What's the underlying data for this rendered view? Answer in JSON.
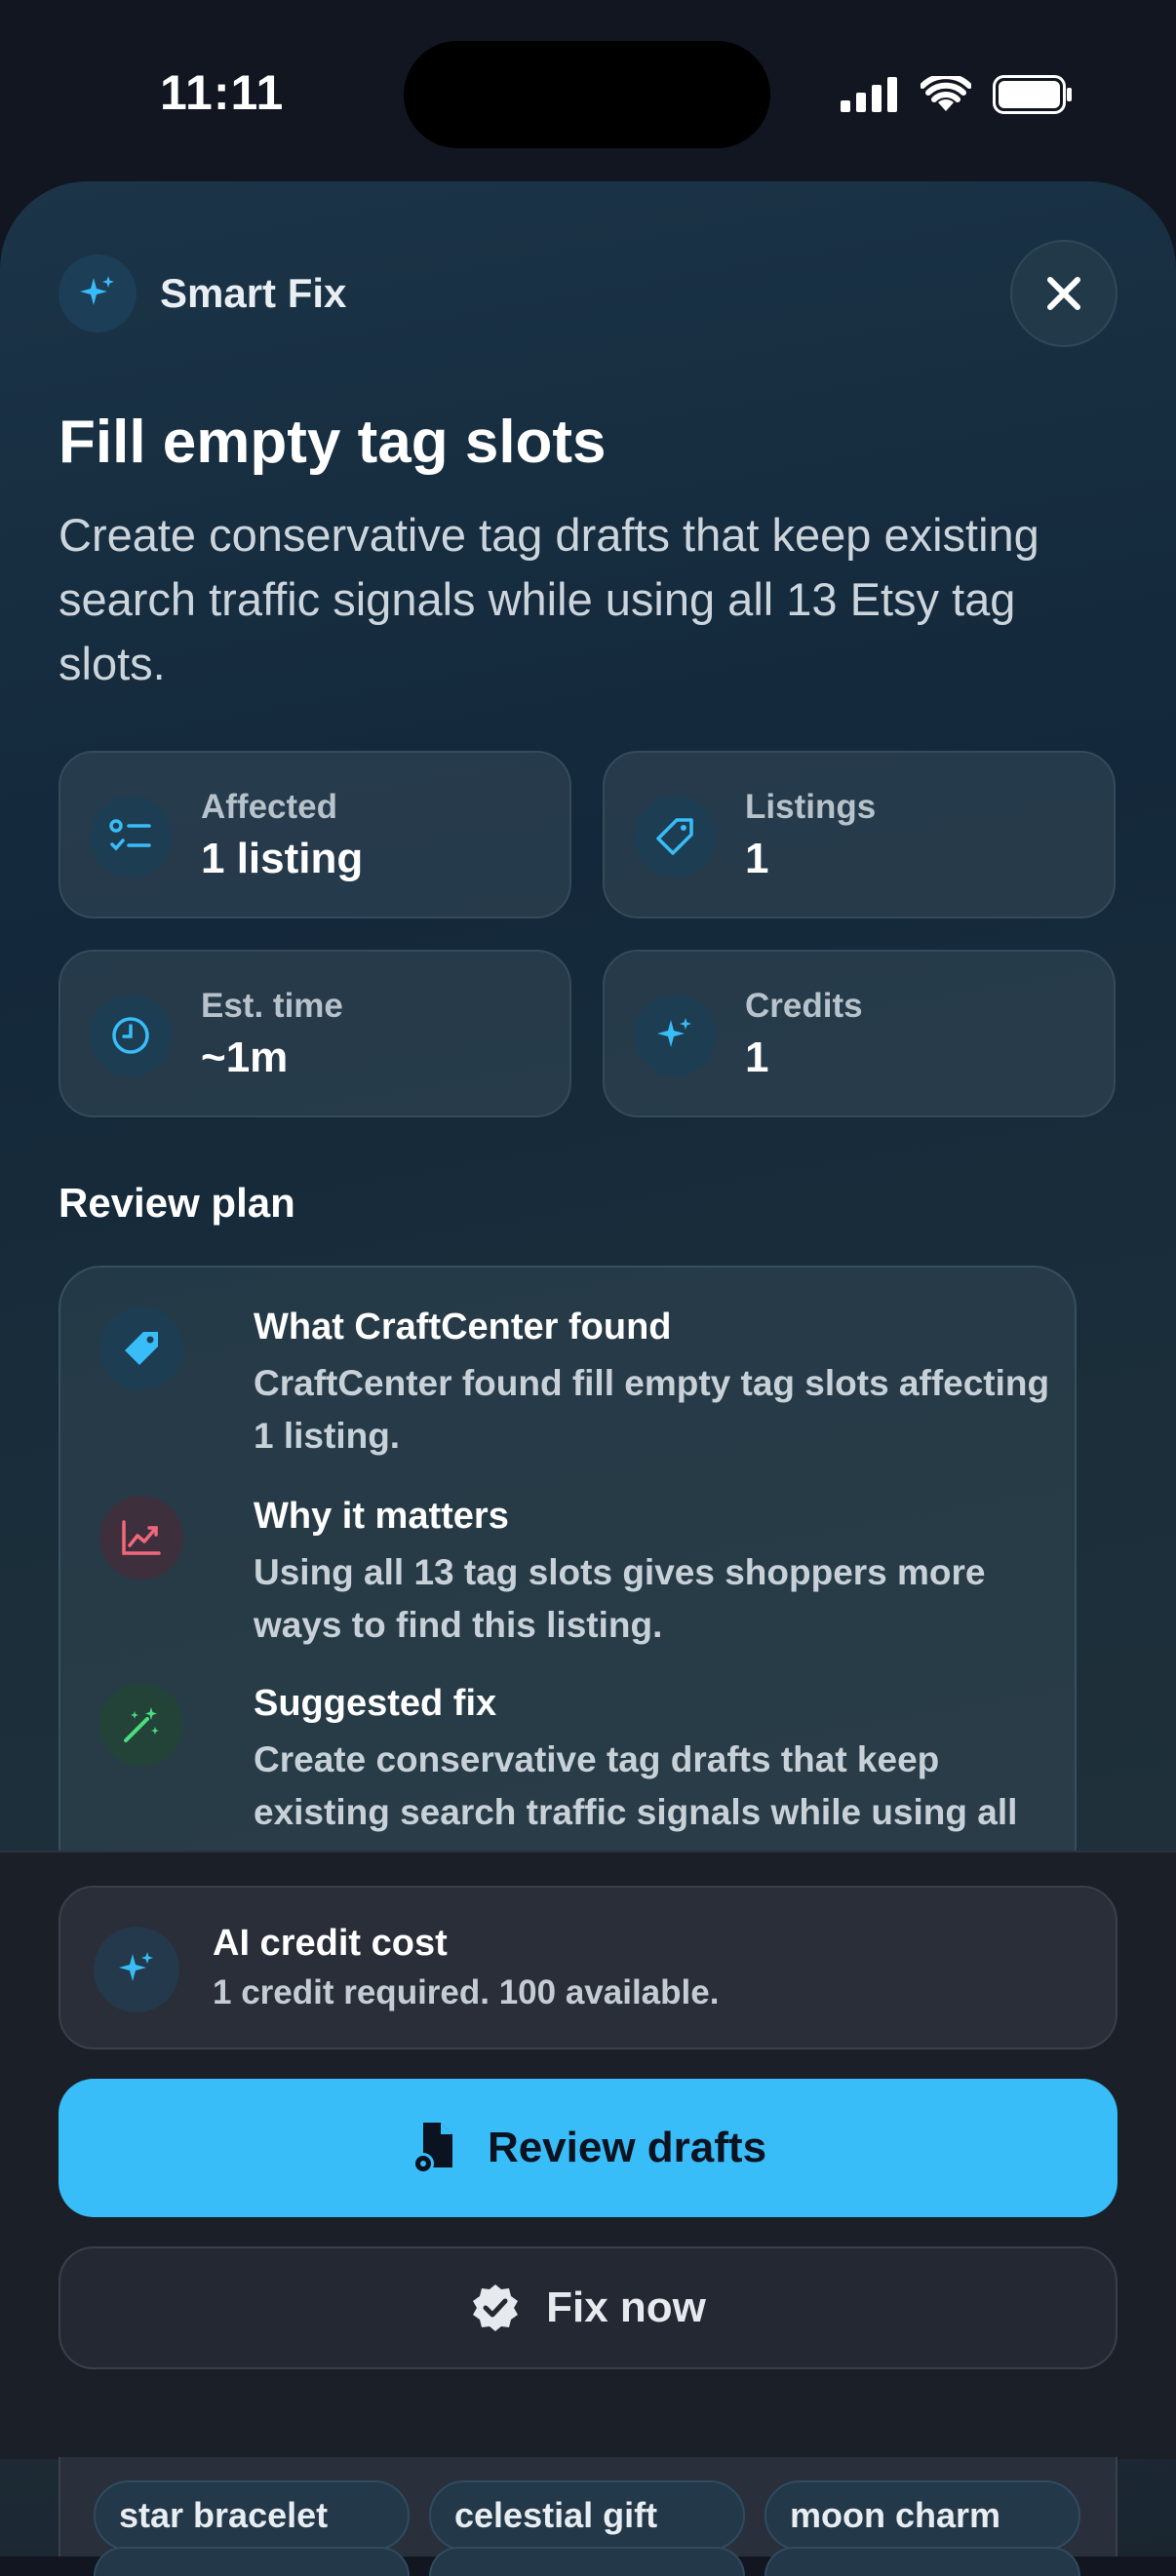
{
  "status_bar": {
    "time": "11:11"
  },
  "sheet": {
    "title": "Smart Fix",
    "heading": "Fill empty tag slots",
    "description": "Create conservative tag drafts that keep existing search traffic signals while using all 13 Etsy tag slots."
  },
  "stats": [
    {
      "label": "Affected",
      "value": "1 listing",
      "icon": "checklist-icon"
    },
    {
      "label": "Listings",
      "value": "1",
      "icon": "tag-icon"
    },
    {
      "label": "Est. time",
      "value": "~1m",
      "icon": "clock-icon"
    },
    {
      "label": "Credits",
      "value": "1",
      "icon": "sparkles-icon"
    }
  ],
  "review_plan": {
    "title": "Review plan",
    "items": [
      {
        "title": "What CraftCenter found",
        "desc": "CraftCenter found fill empty tag slots affecting 1 listing.",
        "icon": "tag-icon",
        "color": "#38bdf8"
      },
      {
        "title": "Why it matters",
        "desc": "Using all 13 tag slots gives shoppers more ways to find this listing.",
        "icon": "trend-chart-icon",
        "color": "#f0697b"
      },
      {
        "title": "Suggested fix",
        "desc": "Create conservative tag drafts that keep existing search traffic signals while using all",
        "icon": "magic-wand-icon",
        "color": "#4ade80"
      }
    ]
  },
  "credit": {
    "title": "AI credit cost",
    "subtitle": "1 credit required. 100 available."
  },
  "buttons": {
    "review_drafts": "Review drafts",
    "fix_now": "Fix now"
  },
  "tags": [
    "star bracelet",
    "celestial gift",
    "moon charm"
  ],
  "colors": {
    "accent": "#38bdf8",
    "background": "#121621"
  }
}
